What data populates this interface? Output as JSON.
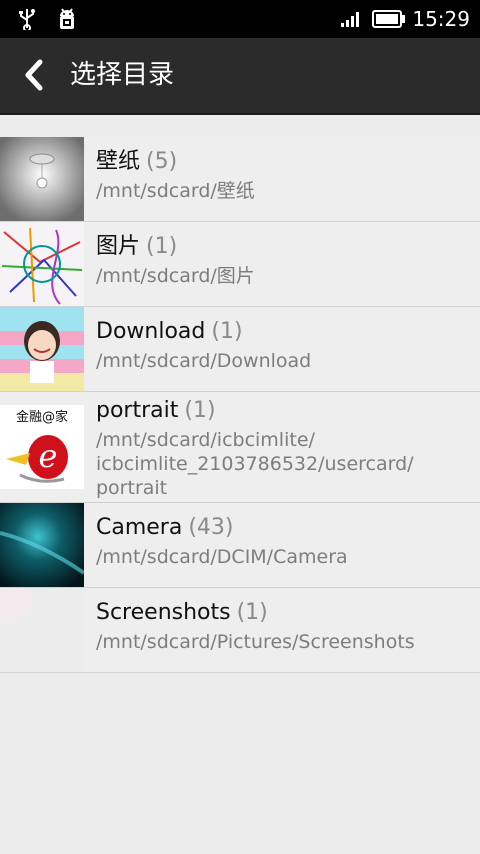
{
  "status_bar": {
    "time": "15:29",
    "icons_left": [
      "usb-icon",
      "android-debug-icon"
    ],
    "icons_right": [
      "signal-icon",
      "battery-icon"
    ]
  },
  "action_bar": {
    "title": "选择目录",
    "back_icon": "chevron-left-icon"
  },
  "folders": [
    {
      "name": "壁纸",
      "count": "(5)",
      "path": "/mnt/sdcard/壁纸"
    },
    {
      "name": "图片",
      "count": "(1)",
      "path": "/mnt/sdcard/图片"
    },
    {
      "name": "Download",
      "count": "(1)",
      "path": "/mnt/sdcard/Download"
    },
    {
      "name": "portrait",
      "count": "(1)",
      "path": "/mnt/sdcard/icbcimlite/\nicbcimlite_2103786532/usercard/\nportrait"
    },
    {
      "name": "Camera",
      "count": "(43)",
      "path": "/mnt/sdcard/DCIM/Camera"
    },
    {
      "name": "Screenshots",
      "count": "(1)",
      "path": "/mnt/sdcard/Pictures/Screenshots"
    }
  ],
  "thumbnail_text": {
    "portrait_logo": "金融@家"
  }
}
